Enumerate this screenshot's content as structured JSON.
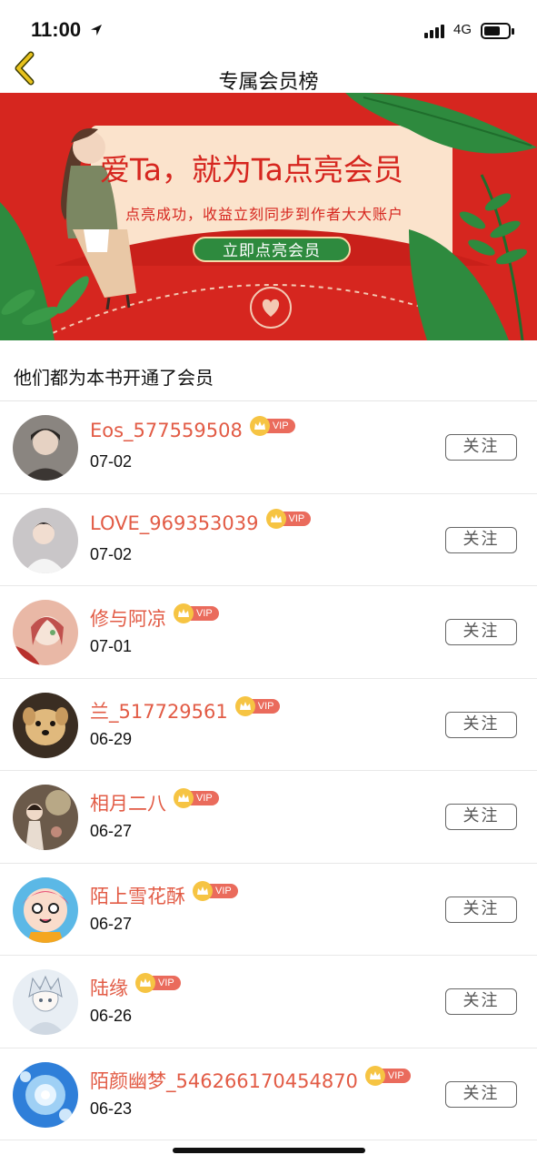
{
  "status_bar": {
    "time": "11:00",
    "network": "4G"
  },
  "nav": {
    "title": "专属会员榜",
    "back_icon": "chevron-left-icon",
    "back_color": "#e8c21c"
  },
  "banner": {
    "slogan": "爱Ta，就为Ta点亮会员",
    "subtitle": "点亮成功，收益立刻同步到作者大大账户",
    "cta_label": "立即点亮会员",
    "background": "#d6261f",
    "accent": "#2e8a3e"
  },
  "section": {
    "title": "他们都为本书开通了会员"
  },
  "vip_badge": {
    "label": "VIP",
    "icon": "crown-icon"
  },
  "follow_label": "关注",
  "members": [
    {
      "name": "Eos_577559508",
      "date": "07-02",
      "avatar_color": "#8a8580"
    },
    {
      "name": "LOVE_969353039",
      "date": "07-02",
      "avatar_color": "#c9c6c8"
    },
    {
      "name": "修与阿凉",
      "date": "07-01",
      "avatar_color": "#e9b8a6"
    },
    {
      "name": "兰_517729561",
      "date": "06-29",
      "avatar_color": "#3a2d22"
    },
    {
      "name": "相月二八",
      "date": "06-27",
      "avatar_color": "#6b5a4a"
    },
    {
      "name": "陌上雪花酥",
      "date": "06-27",
      "avatar_color": "#5bb8e6"
    },
    {
      "name": "陆缘",
      "date": "06-26",
      "avatar_color": "#e8eef4"
    },
    {
      "name": "陌颜幽梦_546266170454870",
      "date": "06-23",
      "avatar_color": "#2f7fd9"
    }
  ]
}
